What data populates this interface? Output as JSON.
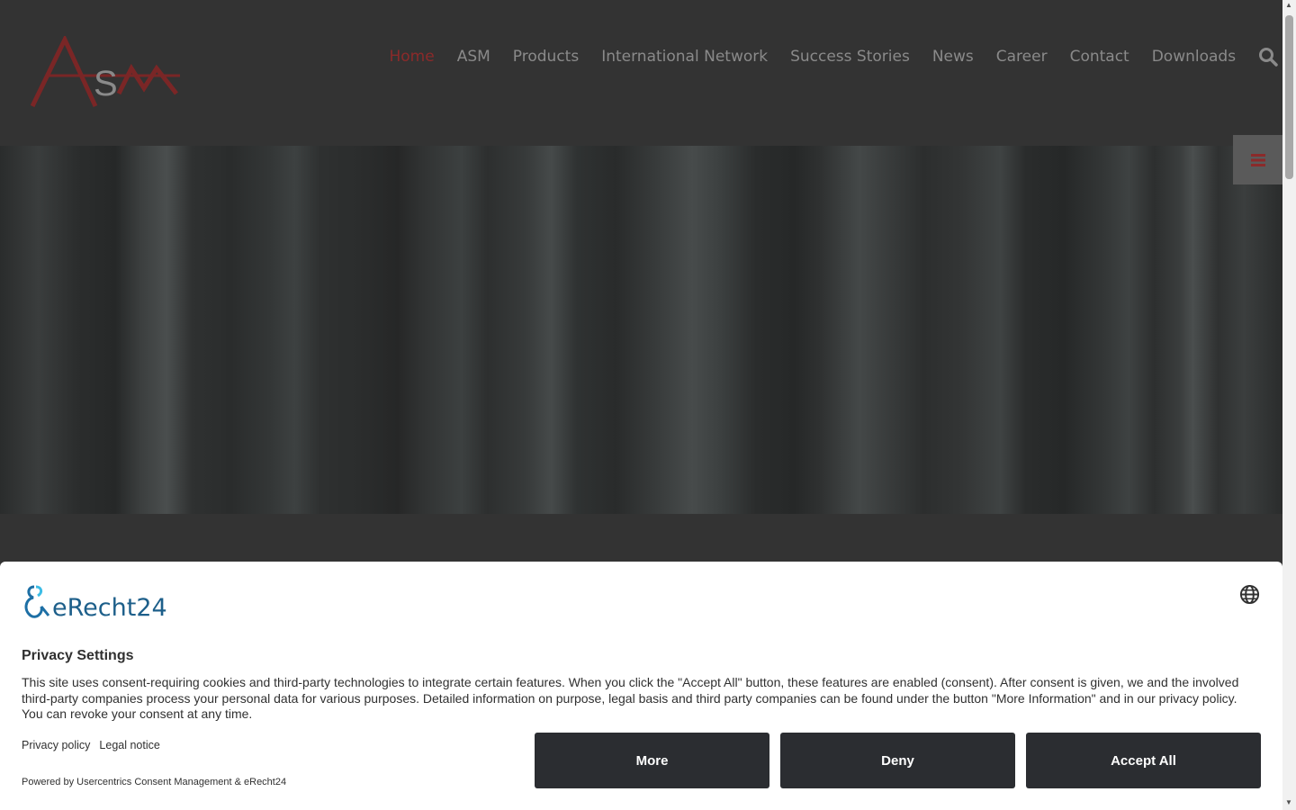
{
  "header": {
    "logo_alt": "ASM",
    "nav": [
      {
        "label": "Home",
        "active": true
      },
      {
        "label": "ASM"
      },
      {
        "label": "Products"
      },
      {
        "label": "International Network"
      },
      {
        "label": "Success Stories"
      },
      {
        "label": "News"
      },
      {
        "label": "Career"
      },
      {
        "label": "Contact"
      },
      {
        "label": "Downloads"
      }
    ],
    "search_icon": "search-icon",
    "accent_color": "#8b2a2a"
  },
  "side_menu_icon": "hamburger-icon",
  "consent": {
    "brand": "eRecht24",
    "language_icon": "globe-icon",
    "title": "Privacy Settings",
    "text": "This site uses consent-requiring cookies and third-party technologies to integrate certain features. When you click the \"Accept All\" button, these features are enabled (consent). After consent is given, we and the involved third-party companies process your personal data for various purposes. Detailed information on purpose, legal basis and third party companies can be found under the button \"More Information\" and in our privacy policy. You can revoke your consent at any time.",
    "links": [
      "Privacy policy",
      "Legal notice"
    ],
    "powered_by": "Powered by Usercentrics Consent Management & eRecht24",
    "buttons": {
      "more": "More",
      "deny": "Deny",
      "accept": "Accept All"
    },
    "button_color": "#2b2d31"
  }
}
